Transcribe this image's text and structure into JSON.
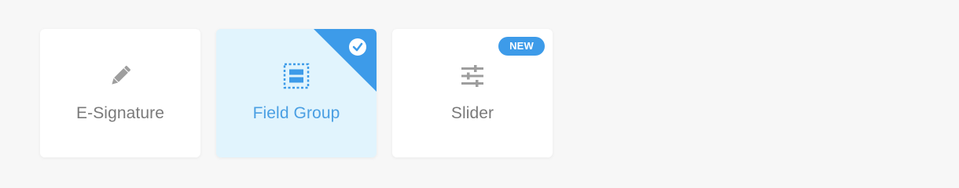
{
  "cards": [
    {
      "label": "E-Signature",
      "icon": "pencil-icon",
      "selected": false
    },
    {
      "label": "Field Group",
      "icon": "field-group-icon",
      "selected": true
    },
    {
      "label": "Slider",
      "icon": "sliders-icon",
      "selected": false,
      "badge": "NEW"
    }
  ],
  "colors": {
    "background": "#f7f7f7",
    "card": "#ffffff",
    "selected_card": "#e1f4fd",
    "accent": "#3d9be9",
    "muted_text": "#7a7a7a",
    "icon_gray": "#9e9e9e"
  }
}
